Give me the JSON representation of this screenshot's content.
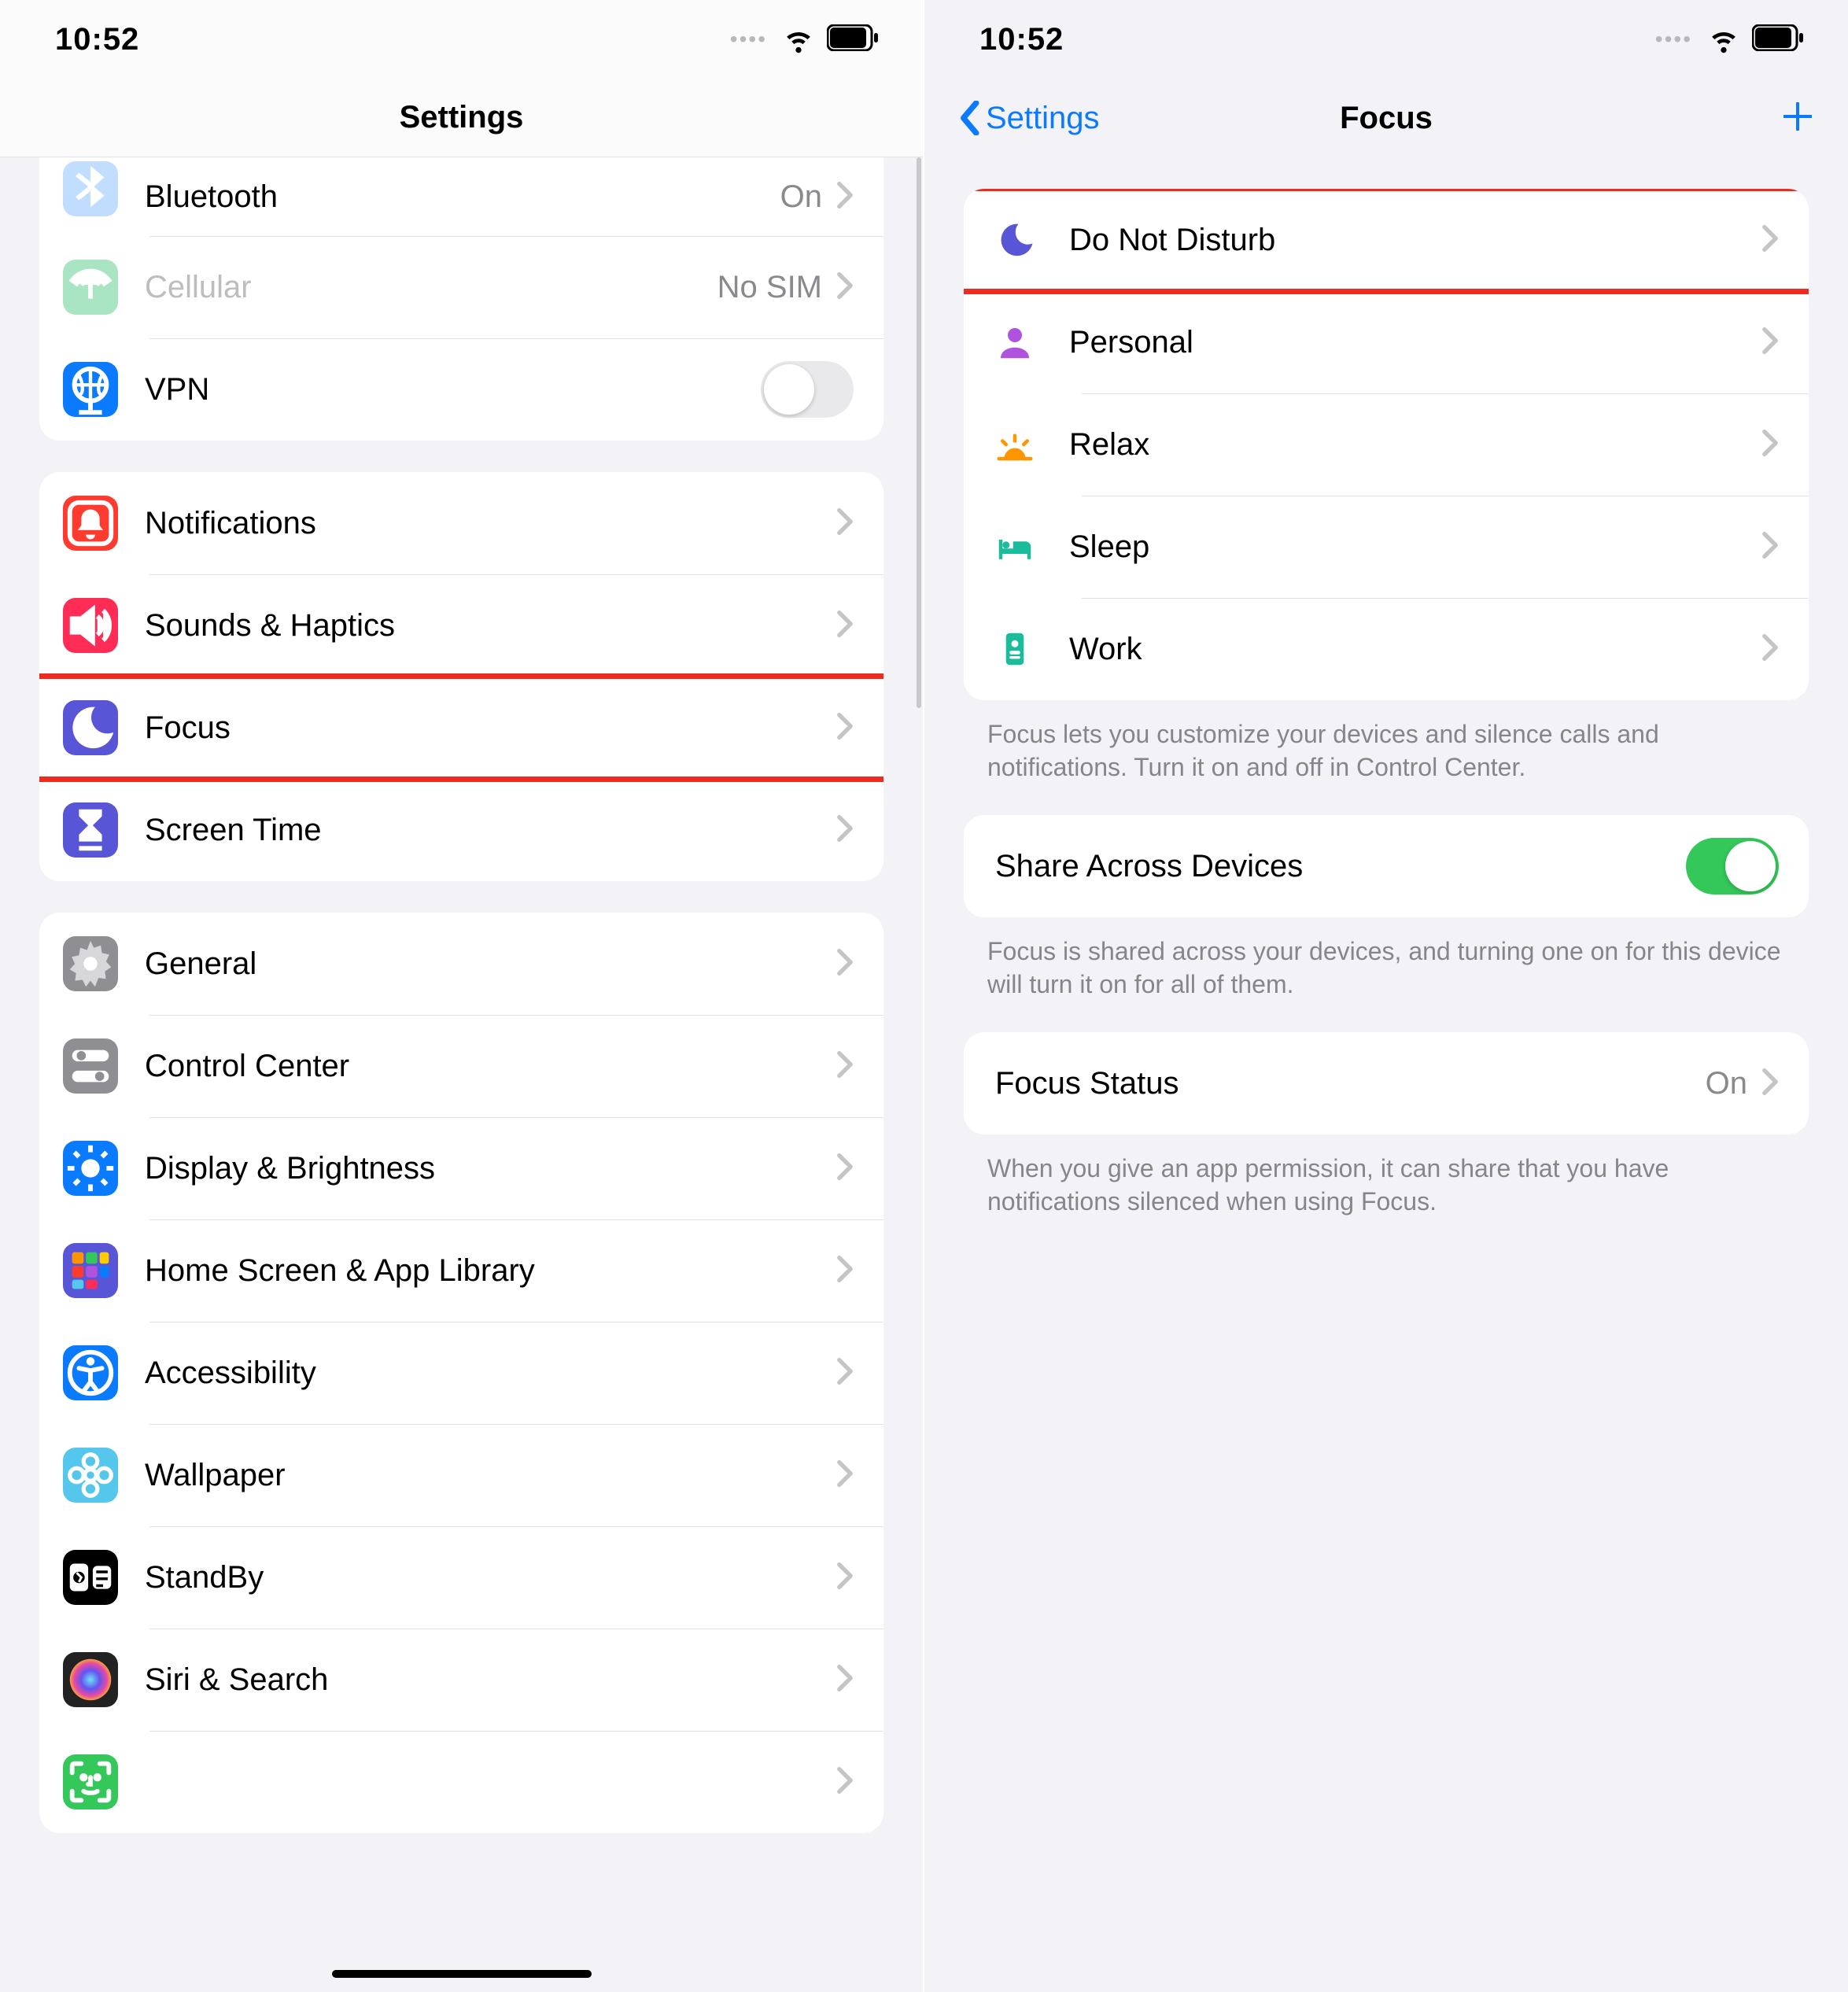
{
  "status": {
    "time": "10:52"
  },
  "left": {
    "title": "Settings",
    "groups": [
      {
        "clip_top": true,
        "rows": [
          {
            "icon": "bluetooth",
            "color": "#0a7aff",
            "label": "Bluetooth",
            "value": "On",
            "chevron": true
          },
          {
            "icon": "cellular",
            "color": "#a9e5c2",
            "label": "Cellular",
            "dim": true,
            "value": "No SIM",
            "chevron": true
          },
          {
            "icon": "vpn",
            "color": "#0a7aff",
            "label": "VPN",
            "toggle": "off"
          }
        ]
      },
      {
        "rows": [
          {
            "icon": "bell",
            "color": "#ff3b30",
            "label": "Notifications",
            "chevron": true
          },
          {
            "icon": "speaker",
            "color": "#ff2d55",
            "label": "Sounds & Haptics",
            "chevron": true
          },
          {
            "icon": "moon",
            "color": "#5856d6",
            "label": "Focus",
            "chevron": true,
            "highlight": true
          },
          {
            "icon": "hourglass",
            "color": "#5856d6",
            "label": "Screen Time",
            "chevron": true
          }
        ]
      },
      {
        "rows": [
          {
            "icon": "gear",
            "color": "#8e8e93",
            "label": "General",
            "chevron": true
          },
          {
            "icon": "switches",
            "color": "#8e8e93",
            "label": "Control Center",
            "chevron": true
          },
          {
            "icon": "sun",
            "color": "#0a7aff",
            "label": "Display & Brightness",
            "chevron": true
          },
          {
            "icon": "apps",
            "color": "#5856d6",
            "label": "Home Screen & App Library",
            "chevron": true
          },
          {
            "icon": "access",
            "color": "#0a7aff",
            "label": "Accessibility",
            "chevron": true
          },
          {
            "icon": "flower",
            "color": "#55c7ec",
            "label": "Wallpaper",
            "chevron": true
          },
          {
            "icon": "standby",
            "color": "#000000",
            "label": "StandBy",
            "chevron": true
          },
          {
            "icon": "siri",
            "color": "#222",
            "label": "Siri & Search",
            "chevron": true
          },
          {
            "icon": "faceid",
            "color": "#34c759",
            "label": "",
            "chevron": true
          }
        ]
      }
    ]
  },
  "right": {
    "back": "Settings",
    "title": "Focus",
    "groups": [
      {
        "rows": [
          {
            "ficon": "moon",
            "fcolor": "#5856d6",
            "label": "Do Not Disturb",
            "chevron": true,
            "highlight": true
          },
          {
            "ficon": "person",
            "fcolor": "#af52de",
            "label": "Personal",
            "chevron": true
          },
          {
            "ficon": "sunrise",
            "fcolor": "#ff9500",
            "label": "Relax",
            "chevron": true
          },
          {
            "ficon": "bed",
            "fcolor": "#1abc9c",
            "label": "Sleep",
            "chevron": true
          },
          {
            "ficon": "badge",
            "fcolor": "#1abc9c",
            "label": "Work",
            "chevron": true
          }
        ],
        "footer": "Focus lets you customize your devices and silence calls and notifications. Turn it on and off in Control Center."
      },
      {
        "rows": [
          {
            "noicon": true,
            "label": "Share Across Devices",
            "toggle": "on"
          }
        ],
        "footer": "Focus is shared across your devices, and turning one on for this device will turn it on for all of them."
      },
      {
        "rows": [
          {
            "noicon": true,
            "label": "Focus Status",
            "value": "On",
            "chevron": true
          }
        ],
        "footer": "When you give an app permission, it can share that you have notifications silenced when using Focus."
      }
    ]
  }
}
